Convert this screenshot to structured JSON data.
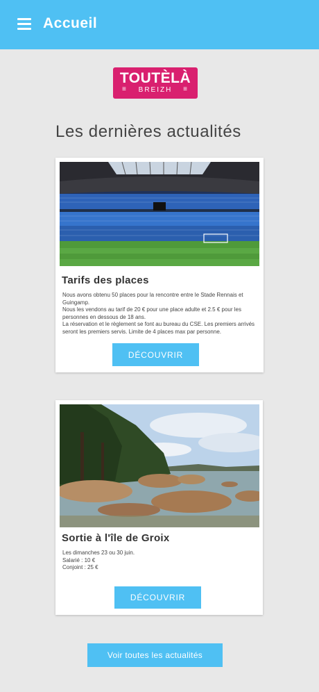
{
  "appbar": {
    "title": "Accueil",
    "menu_icon": "hamburger-menu-icon"
  },
  "logo": {
    "main": "TOUTÈLÀ",
    "sub": "BREIZH",
    "color": "#d9206f"
  },
  "page_title": "Les dernières actualités",
  "articles": [
    {
      "image": "stadium-photo",
      "title": "Tarifs des places",
      "body": [
        "Nous avons obtenu 50 places pour la rencontre entre le Stade Rennais et Guingamp.",
        "Nous les vendons au tarif de 20 € pour une place adulte et 2.5 € pour les personnes en dessous de 18 ans.",
        "La réservation et le règlement se font au bureau du CSE. Les premiers arrivés seront les premiers servis. Limite de 4 places max par personne."
      ],
      "button": "DÉCOUVRIR"
    },
    {
      "image": "coast-photo",
      "title": "Sortie à l'île de Groix",
      "body": [
        "Les dimanches 23 ou 30 juin.",
        "Salarié : 10 €",
        "Conjoint : 25 €"
      ],
      "button": "DÉCOUVRIR"
    }
  ],
  "all_news_button": "Voir toutes les actualités",
  "colors": {
    "accent": "#4fc0f3",
    "background": "#e8e8e8"
  }
}
